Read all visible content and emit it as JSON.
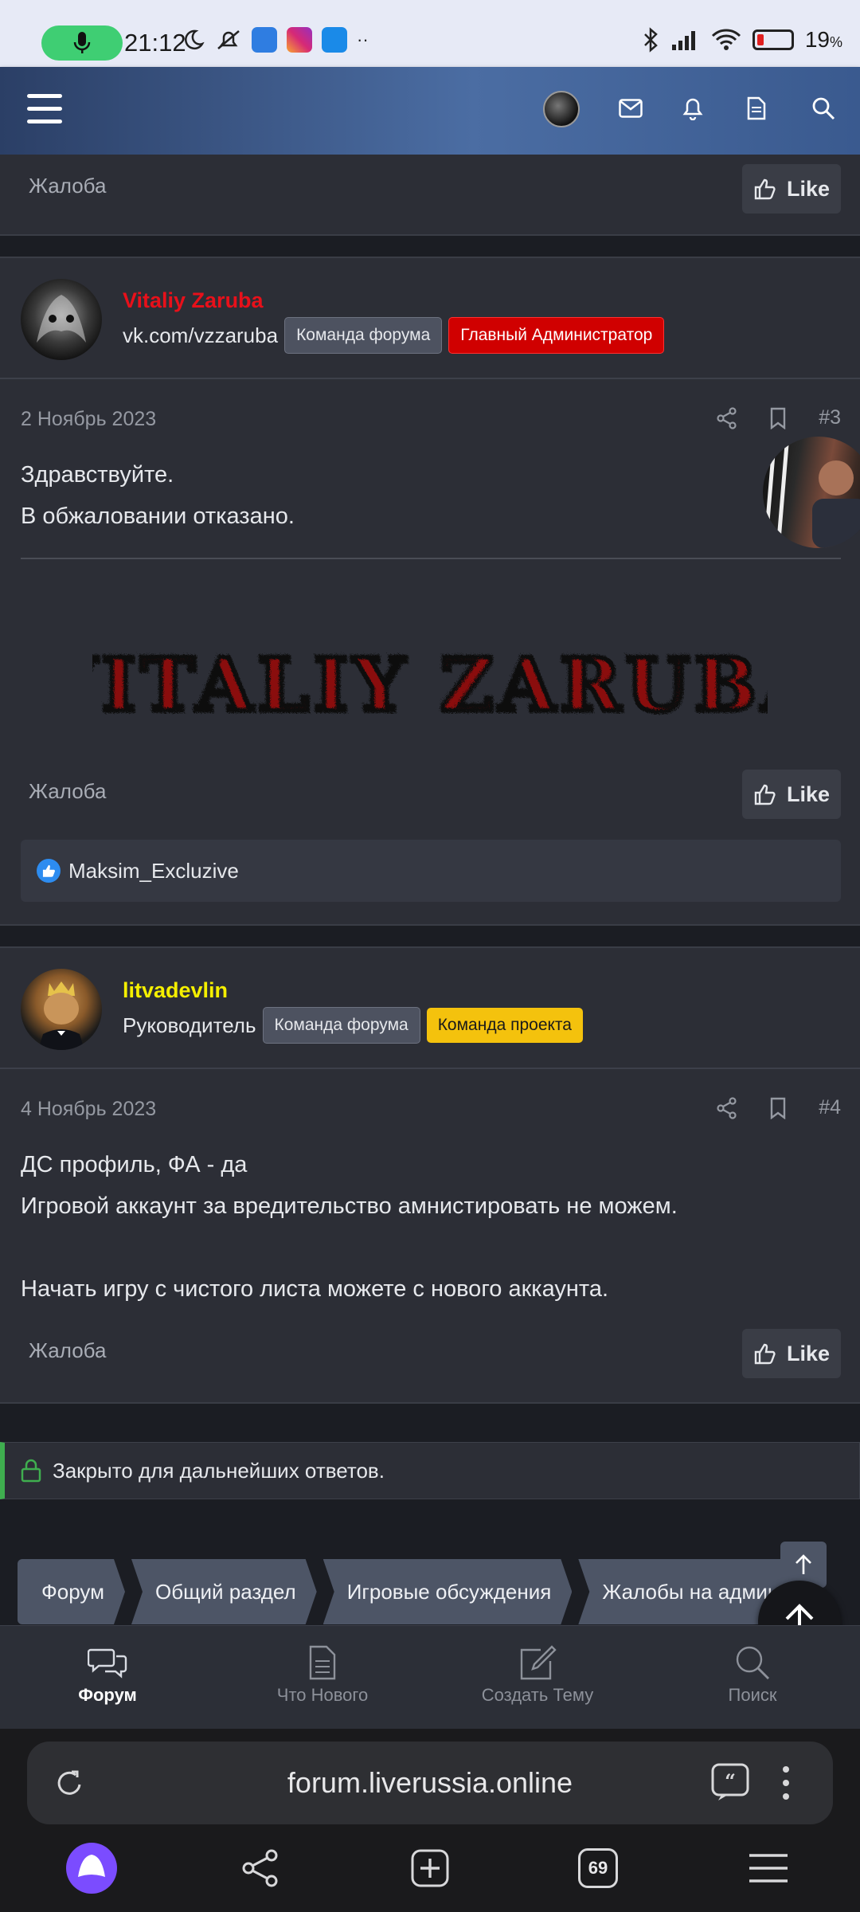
{
  "status_bar": {
    "time": "21:12",
    "battery": "19",
    "battery_unit": "%"
  },
  "posts": [
    {
      "complaint": "Жалоба",
      "like": "Like"
    },
    {
      "username": "Vitaliy Zaruba",
      "user_title": "vk.com/vzzaruba",
      "badges": [
        "Команда форума",
        "Главный Администратор"
      ],
      "date": "2 Ноябрь 2023",
      "number": "#3",
      "body": "Здравствуйте.\nВ обжаловании отказано.",
      "complaint": "Жалоба",
      "like": "Like",
      "reaction_user": "Maksim_Excluzive"
    },
    {
      "username": "litvadevlin",
      "user_title": "Руководитель",
      "badges": [
        "Команда форума",
        "Команда проекта"
      ],
      "date": "4 Ноябрь 2023",
      "number": "#4",
      "body": "ДС профиль, ФА - да\nИгровой аккаунт за вредительство амнистировать не можем.\n\nНачать игру с чистого листа можете с нового аккаунта.",
      "complaint": "Жалоба",
      "like": "Like"
    }
  ],
  "closed_notice": "Закрыто для дальнейших ответов.",
  "breadcrumb": [
    "Форум",
    "Общий раздел",
    "Игровые обсуждения",
    "Жалобы на админ"
  ],
  "tabbar": [
    {
      "label": "Форум",
      "icon": "chat-bubbles-icon",
      "active": true
    },
    {
      "label": "Что Нового",
      "icon": "document-icon"
    },
    {
      "label": "Создать Тему",
      "icon": "edit-icon"
    },
    {
      "label": "Поиск",
      "icon": "search-icon"
    }
  ],
  "browser": {
    "url": "forum.liverussia.online",
    "tabs_count": "69"
  },
  "colors": {
    "admin_name": "#e8101a",
    "leader_name": "#f5ef00",
    "closed_accent": "#3fae4f"
  }
}
